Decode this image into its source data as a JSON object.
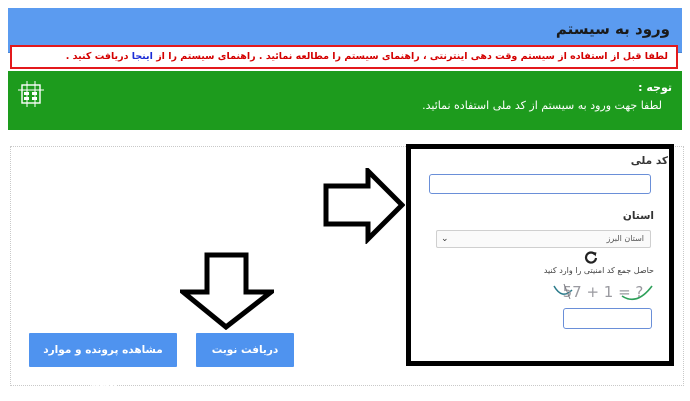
{
  "header": {
    "title": "ورود به سیستم"
  },
  "notice": {
    "text_before": "لطفا قبل از استفاده از سیستم وقت دهی اینترنتی ، راهنمای سیستم را مطالعه نمائید . راهنمای سیستم را از",
    "link": "اینجا",
    "text_after": "دریافت کنید ."
  },
  "attention": {
    "title": "توجه :",
    "text": "لطفا جهت ورود به سیستم از کد ملی استفاده نمائید.",
    "icon": "grid-icon"
  },
  "form": {
    "national_code_label": "کد ملی",
    "national_code_value": "",
    "province_label": "استان",
    "province_selected": "استان البرز",
    "captcha_hint": "حاصل جمع کد امنیتی را وارد کنید",
    "captcha_text": "57 + 1 = ?",
    "captcha_answer": ""
  },
  "buttons": {
    "get_turn": "دریافت نوبت",
    "view_more": "مشاهده پرونده و موارد بیشتر"
  },
  "colors": {
    "header_bg": "#5b9bf0",
    "notice_border": "#e3191c",
    "attention_bg": "#1d9b1d",
    "button_bg": "#4f93ef"
  }
}
